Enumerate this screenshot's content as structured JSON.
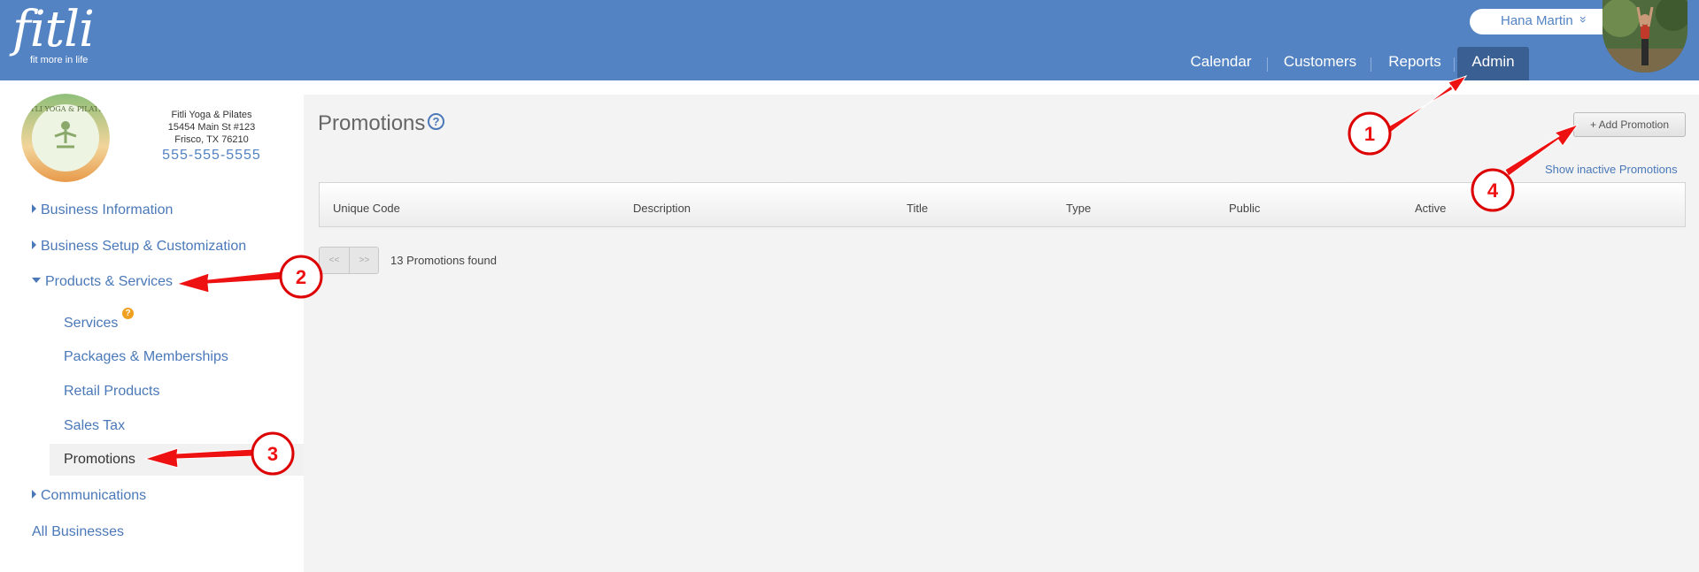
{
  "header": {
    "logo_text": "fitli",
    "logo_tagline": "fit more in life",
    "user_name": "Hana Martin",
    "user_chevron": "»",
    "nav": [
      {
        "label": "Calendar"
      },
      {
        "label": "Customers"
      },
      {
        "label": "Reports"
      },
      {
        "label": "Admin",
        "active": true
      }
    ]
  },
  "business": {
    "logo_text": "FITLI YOGA & PILATES",
    "name": "Fitli Yoga & Pilates",
    "address1": "15454 Main St #123",
    "address2": "Frisco, TX 76210",
    "phone": "555-555-5555"
  },
  "sidebar": {
    "items": [
      {
        "label": "Business Information"
      },
      {
        "label": "Business Setup & Customization"
      },
      {
        "label": "Products & Services",
        "expanded": true
      },
      {
        "label": "Communications"
      },
      {
        "label": "All Businesses"
      }
    ],
    "subitems": [
      {
        "label": "Services",
        "badge": "?"
      },
      {
        "label": "Packages & Memberships"
      },
      {
        "label": "Retail Products"
      },
      {
        "label": "Sales Tax"
      },
      {
        "label": "Promotions",
        "active": true
      }
    ]
  },
  "main": {
    "title": "Promotions",
    "help_glyph": "?",
    "add_button": "+ Add Promotion",
    "inactive_link": "Show inactive Promotions",
    "columns": [
      "Unique Code",
      "Description",
      "Title",
      "Type",
      "Public",
      "Active"
    ],
    "pager_prev": "<<",
    "pager_next": ">>",
    "found_text": "13 Promotions found"
  },
  "annotations": {
    "markers": [
      "1",
      "2",
      "3",
      "4"
    ],
    "color": "#ff0000"
  },
  "colors": {
    "header": "#5383c3",
    "nav_active": "#3a5f93",
    "link": "#4a78b8",
    "panel": "#f3f3f3"
  }
}
